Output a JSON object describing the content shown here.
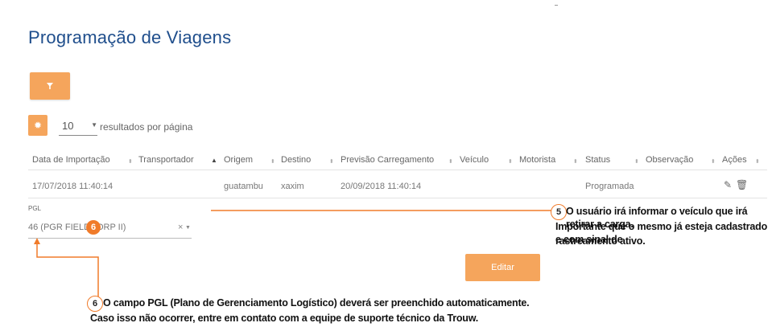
{
  "page": {
    "title": "Programação de Viagens"
  },
  "filter_button": {
    "icon": "filter-icon"
  },
  "pagination": {
    "icon": "gear-icon",
    "page_size": "10",
    "label": "resultados por página"
  },
  "table": {
    "columns": [
      "Data de Importação",
      "Transportador",
      "Origem",
      "Destino",
      "Previsão Carregamento",
      "Veículo",
      "Motorista",
      "Status",
      "Observação",
      "Ações"
    ],
    "rows": [
      {
        "data_importacao": "17/07/2018 11:40:14",
        "transportador": "",
        "origem": "guatambu",
        "destino": "xaxim",
        "previsao": "20/09/2018 11:40:14",
        "veiculo": "",
        "motorista": "",
        "status": "Programada",
        "observacao": "",
        "actions": [
          "edit-icon",
          "trash-icon"
        ]
      }
    ]
  },
  "pgl": {
    "label": "PGL",
    "value": "46 (PGR FIELDCORP II)",
    "clear": "×"
  },
  "editar_button": {
    "label": "Editar"
  },
  "annotations": {
    "five": {
      "number": "5",
      "line1": "O usuário irá informar o veículo que irá retirar a carga.",
      "line2": "Importante que o mesmo já esteja cadastrado e com sinal de",
      "line3": "rastreamento ativo."
    },
    "six": {
      "number": "6",
      "line1": "O campo PGL (Plano de Gerenciamento Logístico) deverá ser preenchido automaticamente.",
      "line2": "Caso isso não ocorrer, entre em contato com a equipe de suporte técnico da Trouw."
    }
  },
  "colors": {
    "accent": "#f5a55c",
    "annotation": "#f07b2a",
    "title": "#1f4e8c"
  }
}
